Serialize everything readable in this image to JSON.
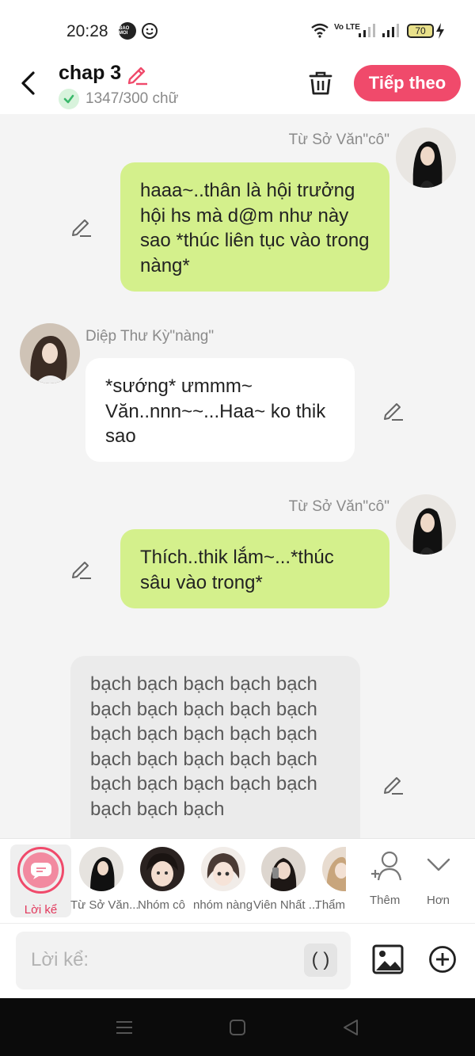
{
  "status_bar": {
    "time": "20:28",
    "app_badge": "BAO MOI",
    "network": "Vo LTE",
    "battery": "70"
  },
  "header": {
    "title": "chap 3",
    "word_count": "1347/300 chữ",
    "next_label": "Tiếp theo"
  },
  "messages": [
    {
      "speaker": "Từ Sở Văn\"cô\"",
      "side": "right",
      "text": "haaa~..thân là hội trưởng hội hs mà d@m như này sao *thúc liên tục vào trong nàng*"
    },
    {
      "speaker": "Diệp Thư Kỳ\"nàng\"",
      "side": "left",
      "text": "*sướng* ưmmm~ Văn..nnn~~...Haa~ ko thik sao"
    },
    {
      "speaker": "Từ Sở Văn\"cô\"",
      "side": "right",
      "text": "Thích..thik lắm~...*thúc sâu vào trong*"
    },
    {
      "speaker": "",
      "side": "narration",
      "text": "bạch bạch bạch bạch bạch bạch bạch bạch bạch bạch bạch bạch bạch bạch bạch bạch bạch bạch bạch bạch bạch bạch bạch bạch bạch bạch bạch bạch"
    }
  ],
  "characters": {
    "narrator_label": "Lời kể",
    "items": [
      "Từ Sở Văn...",
      "Nhóm cô",
      "nhóm nàng",
      "Viên Nhất ...",
      "Thẩm"
    ],
    "more_label": "Thêm",
    "less_label": "Hơn"
  },
  "input": {
    "placeholder": "Lời kể:",
    "paren_label": "( )"
  },
  "colors": {
    "accent": "#f04a6b",
    "green_bubble": "#d4f08c",
    "background": "#f4f4f4"
  }
}
